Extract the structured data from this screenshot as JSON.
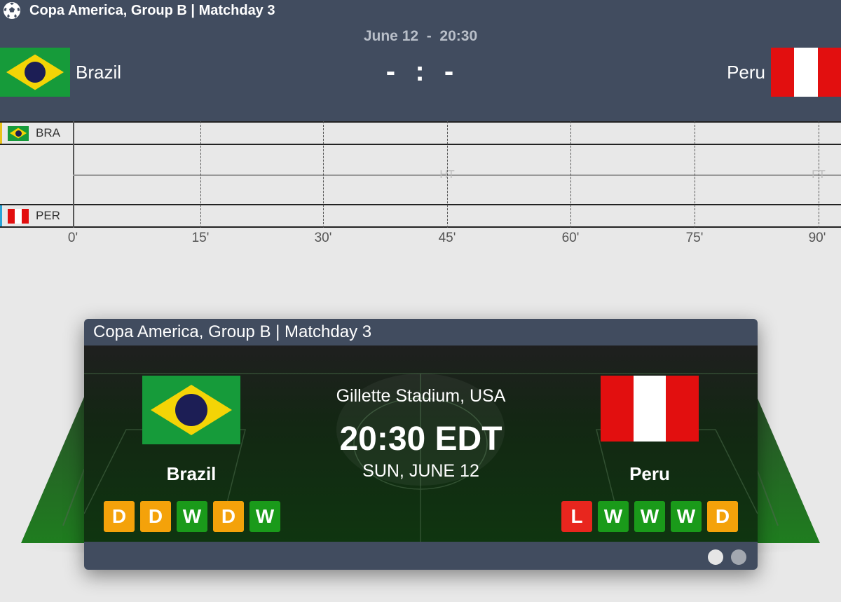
{
  "header": {
    "competition": "Copa America, Group B | Matchday 3",
    "date": "June 12",
    "time": "20:30",
    "home_score": "-",
    "away_score": "-",
    "home_team": "Brazil",
    "away_team": "Peru"
  },
  "timeline": {
    "home_code": "BRA",
    "away_code": "PER",
    "ticks": [
      "0'",
      "15'",
      "30'",
      "45'",
      "60'",
      "75'",
      "90'"
    ],
    "ht_label": "HT",
    "ft_label": "FT"
  },
  "widget": {
    "title": "Copa America, Group B | Matchday 3",
    "stadium": "Gillette Stadium, USA",
    "kickoff": "20:30 EDT",
    "day": "SUN, JUNE 12",
    "home_team": "Brazil",
    "away_team": "Peru",
    "home_form": [
      "D",
      "D",
      "W",
      "D",
      "W"
    ],
    "away_form": [
      "L",
      "W",
      "W",
      "W",
      "D"
    ]
  },
  "colors": {
    "header_bg": "#414c5f",
    "win": "#1a9a1a",
    "draw": "#f4a20a",
    "loss": "#e8261e",
    "brazil_green": "#169b3a",
    "brazil_yellow": "#f4d406",
    "peru_red": "#e20f0f"
  },
  "icons": {
    "competition": "soccer-ball-icon"
  }
}
